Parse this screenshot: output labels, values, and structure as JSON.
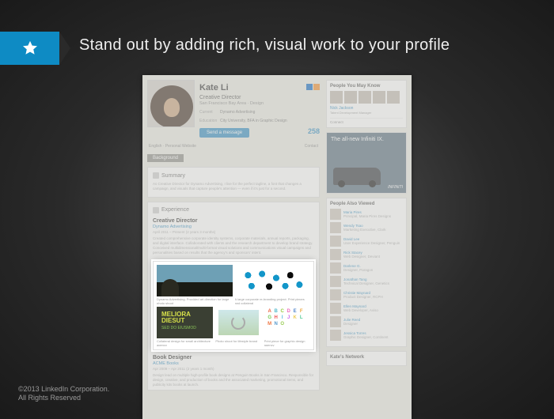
{
  "slide": {
    "headline": "Stand out by adding rich, visual work to your profile",
    "copyright_line1": "©2013 LinkedIn Corporation.",
    "copyright_line2": "All Rights Reserved"
  },
  "profile": {
    "name": "Kate Li",
    "title": "Creative Director",
    "location": "San Francisco Bay Area · Design",
    "current_label": "Current",
    "current_value": "Dynamo Advertising",
    "education_label": "Education",
    "education_value": "City University, BFA in Graphic Design",
    "send_message": "Send a message",
    "connections": "258",
    "tabs_left": "English · Personal Website",
    "tabs_right": "Contact",
    "background_tab": "Background",
    "summary_label": "Summary",
    "summary_text": "As Creative Director for Dynamo Advertising, I live for the perfect tagline, a font that changes a campaign, and visuals that capture people's attention — even if it's just for a second.",
    "experience_label": "Experience",
    "job1_title": "Creative Director",
    "job1_company": "Dynamo Advertising",
    "job1_dates": "April 2011 – Present (2 years 3 months)",
    "job1_desc": "Created comprehensive corporate identity systems, corporate materials, annual reports, packaging, and digital interface. Collaborated with clients and the research department to develop brand strategy. Conceived multidimensional/multi-format visual solutions and communications visual campaigns and personalities based on results that the agency's and sponsors' intent.",
    "job2_title": "Book Designer",
    "job2_company": "ACME Books",
    "job2_dates": "Apr 2009 – Apr 2011 (2 years 1 month)"
  },
  "gallery": {
    "items": [
      {
        "caption": "Dynamo Advertising. Provided art direction for large photo shoot"
      },
      {
        "caption": "A large corporate re-branding project. Print pieces and collateral"
      },
      {
        "caption": "Collateral design for small architecture agency"
      },
      {
        "caption": "Photo shoot for lifestyle brand"
      },
      {
        "caption": "Print piece for graphic design agency"
      }
    ],
    "meliora1": "MELIORA",
    "meliora2": "DIESUT",
    "meliora3": "SED DO EIUSMOD"
  },
  "sidebar": {
    "pymk_title": "People You May Know",
    "pymk_name": "Nick Jackson",
    "pymk_role": "Talent Development Manager",
    "pymk_connect": "Connect",
    "ad_title": "The all-new Infiniti IX.",
    "ad_logo": "INFINITI",
    "pav_title": "People Also Viewed",
    "pav": [
      {
        "name": "Maria Pires",
        "role": "Principal, Maria Pires Designs"
      },
      {
        "name": "Wendy Tsao",
        "role": "Marketing Executive, Clark"
      },
      {
        "name": "David Lee",
        "role": "User Experience Designer, Penguin"
      },
      {
        "name": "Rick Stacey",
        "role": "Web Designer, Deviant"
      },
      {
        "name": "Darlene G.",
        "role": "Designer, Paragon"
      },
      {
        "name": "Jonathan Tang",
        "role": "Technical Designer, Genetics"
      },
      {
        "name": "Christie Maynard",
        "role": "Product Designer, RCPH"
      },
      {
        "name": "Ellen Maynard",
        "role": "Web Developer, Aviso"
      },
      {
        "name": "Julie Reed",
        "role": "Designer"
      },
      {
        "name": "Jessica Torres",
        "role": "Graphic Designer, Continent"
      }
    ],
    "network_title": "Kate's Network"
  }
}
